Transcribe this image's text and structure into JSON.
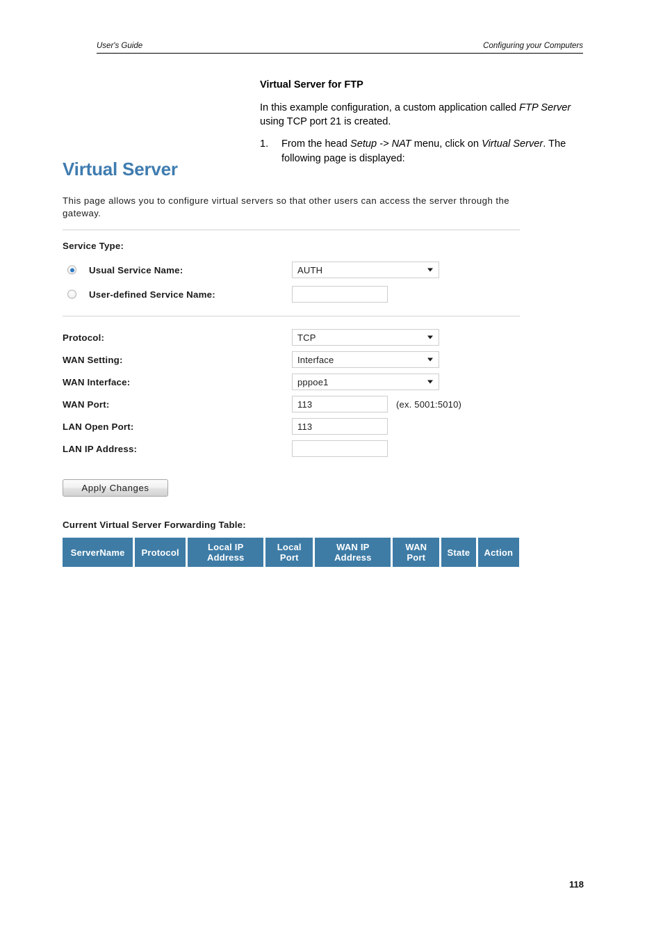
{
  "page_header": {
    "left": "User's Guide",
    "right": "Configuring your Computers"
  },
  "doc": {
    "heading": "Virtual Server for FTP",
    "paragraph": {
      "part1": "In this example configuration, a custom application called ",
      "italic1": "FTP Server",
      "part2": " using TCP port 21 is created."
    },
    "steps": [
      {
        "number": "1.",
        "part1": "From the head ",
        "italic1": "Setup -> NAT",
        "part2": " menu, click on ",
        "italic2": "Virtual Server",
        "part3": ". The following page is displayed:"
      }
    ]
  },
  "router_ui": {
    "title": "Virtual Server",
    "description": "This page allows you to configure virtual servers so that other users can access the server through the gateway.",
    "service_type_label": "Service Type:",
    "usual_service": {
      "label": "Usual Service Name:",
      "radio_selected": true,
      "value": "AUTH"
    },
    "user_defined_service": {
      "label": "User-defined Service Name:",
      "radio_selected": false,
      "value": "",
      "placeholder": ""
    },
    "fields": [
      {
        "label": "Protocol:",
        "type": "select",
        "value": "TCP"
      },
      {
        "label": "WAN Setting:",
        "type": "select",
        "value": "Interface"
      },
      {
        "label": "WAN Interface:",
        "type": "select",
        "value": "pppoe1"
      },
      {
        "label": "WAN Port:",
        "type": "input",
        "value": "113",
        "hint": "(ex. 5001:5010)"
      },
      {
        "label": "LAN Open Port:",
        "type": "input",
        "value": "113",
        "hint": ""
      },
      {
        "label": "LAN IP Address:",
        "type": "input",
        "value": "",
        "hint": ""
      }
    ],
    "apply_button": "Apply Changes",
    "table_caption": "Current Virtual Server Forwarding Table:",
    "table_headers": [
      "ServerName",
      "Protocol",
      "Local IP Address",
      "Local Port",
      "WAN IP Address",
      "WAN Port",
      "State",
      "Action"
    ],
    "table_rows": [],
    "colors": {
      "title_blue": "#3f7cb0",
      "table_header_blue": "#3e7ca6",
      "radio_accent": "#2c79c4"
    }
  },
  "page_number": "118"
}
